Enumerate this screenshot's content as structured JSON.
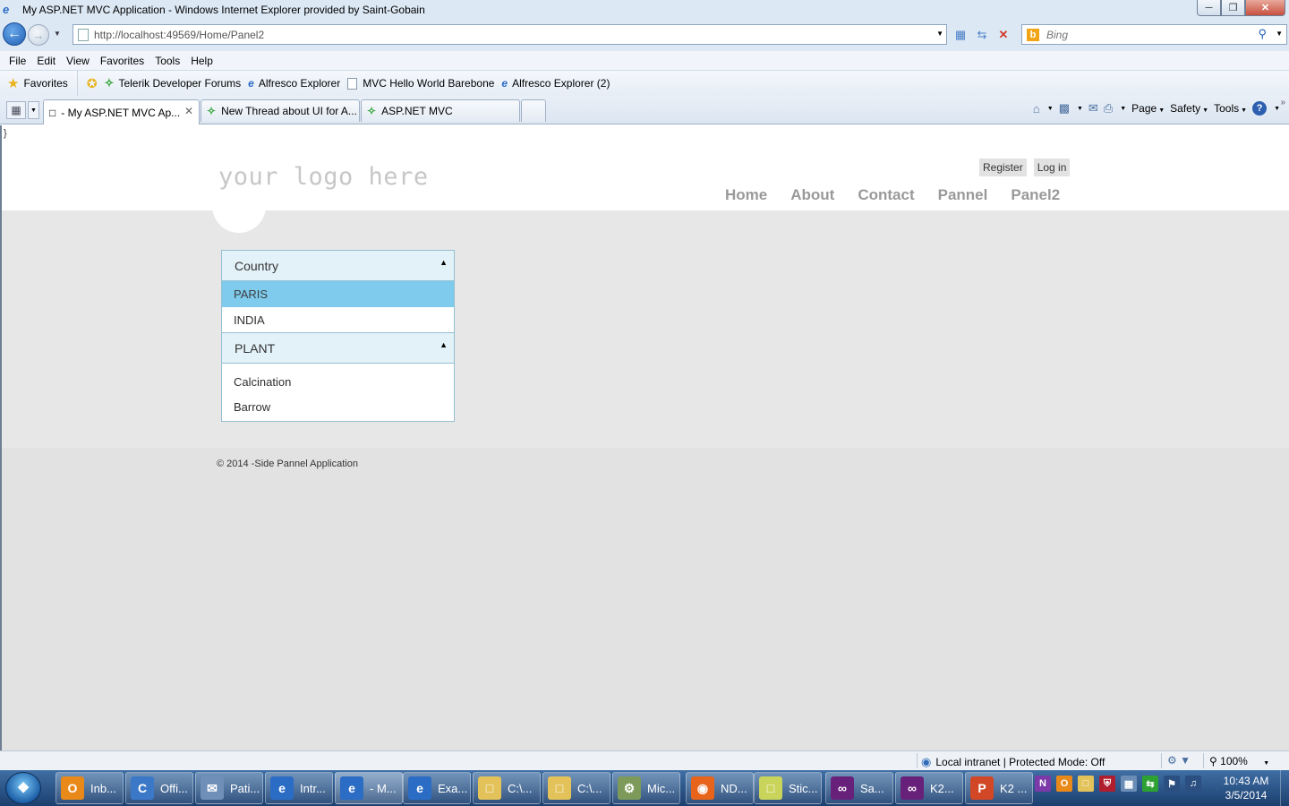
{
  "window": {
    "title": "My ASP.NET MVC Application - Windows Internet Explorer provided by Saint-Gobain",
    "minimize": "─",
    "maximize": "❐",
    "close": "✕"
  },
  "address": {
    "url": "http://localhost:49569/Home/Panel2",
    "search_placeholder": "Bing"
  },
  "menu": [
    "File",
    "Edit",
    "View",
    "Favorites",
    "Tools",
    "Help"
  ],
  "favorites": {
    "label": "Favorites",
    "items": [
      {
        "label": "Telerik Developer Forums",
        "icon": "telerik-icon"
      },
      {
        "label": "Alfresco Explorer",
        "icon": "ie-page-icon"
      },
      {
        "label": "MVC Hello World Barebone",
        "icon": "page-icon"
      },
      {
        "label": "Alfresco Explorer (2)",
        "icon": "ie-page-icon"
      }
    ]
  },
  "tabs": [
    {
      "label": "- My ASP.NET MVC Ap...",
      "active": true
    },
    {
      "label": "New Thread about UI for A...",
      "active": false
    },
    {
      "label": "ASP.NET MVC",
      "active": false
    }
  ],
  "commandbar": {
    "page": "Page",
    "safety": "Safety",
    "tools": "Tools"
  },
  "page": {
    "stray_char": "}",
    "logo": "your logo here",
    "register": "Register",
    "login": "Log in",
    "nav": [
      "Home",
      "About",
      "Contact",
      "Pannel",
      "Panel2"
    ],
    "panelbar": {
      "groups": [
        {
          "header": "Country",
          "items": [
            "PARIS",
            "INDIA"
          ],
          "selected": "PARIS"
        },
        {
          "header": "PLANT",
          "items": [
            "Calcination",
            "Barrow"
          ]
        }
      ]
    },
    "footer": "© 2014 -Side Pannel Application"
  },
  "status": {
    "zone": "Local intranet | Protected Mode: Off",
    "zoom": "100%"
  },
  "taskbar": {
    "items": [
      {
        "label": "Inb...",
        "icon": "outlook-icon",
        "color": "#e8891a"
      },
      {
        "label": "Offi...",
        "icon": "communicator-icon",
        "color": "#3c78c8"
      },
      {
        "label": "Pati...",
        "icon": "chat-icon",
        "color": "#6f8fb8"
      },
      {
        "label": "Intr...",
        "icon": "ie-icon",
        "color": "#2b6cc4"
      },
      {
        "label": "- M...",
        "icon": "ie-icon",
        "color": "#2b6cc4"
      },
      {
        "label": "Exa...",
        "icon": "ie-icon",
        "color": "#2b6cc4"
      },
      {
        "label": "C:\\...",
        "icon": "folder-icon",
        "color": "#e3c25a"
      },
      {
        "label": "C:\\...",
        "icon": "folder-icon",
        "color": "#e3c25a"
      },
      {
        "label": "Mic...",
        "icon": "tools-icon",
        "color": "#7d9a5a"
      },
      {
        "label": "ND...",
        "icon": "firefox-icon",
        "color": "#e8641a"
      },
      {
        "label": "Stic...",
        "icon": "sticky-notes-icon",
        "color": "#c9d45a"
      },
      {
        "label": "Sa...",
        "icon": "visual-studio-icon",
        "color": "#68217a"
      },
      {
        "label": "K2...",
        "icon": "visual-studio-icon",
        "color": "#68217a"
      },
      {
        "label": "K2 ...",
        "icon": "powerpoint-icon",
        "color": "#d24726"
      }
    ],
    "time": "10:43 AM",
    "date": "3/5/2014"
  }
}
